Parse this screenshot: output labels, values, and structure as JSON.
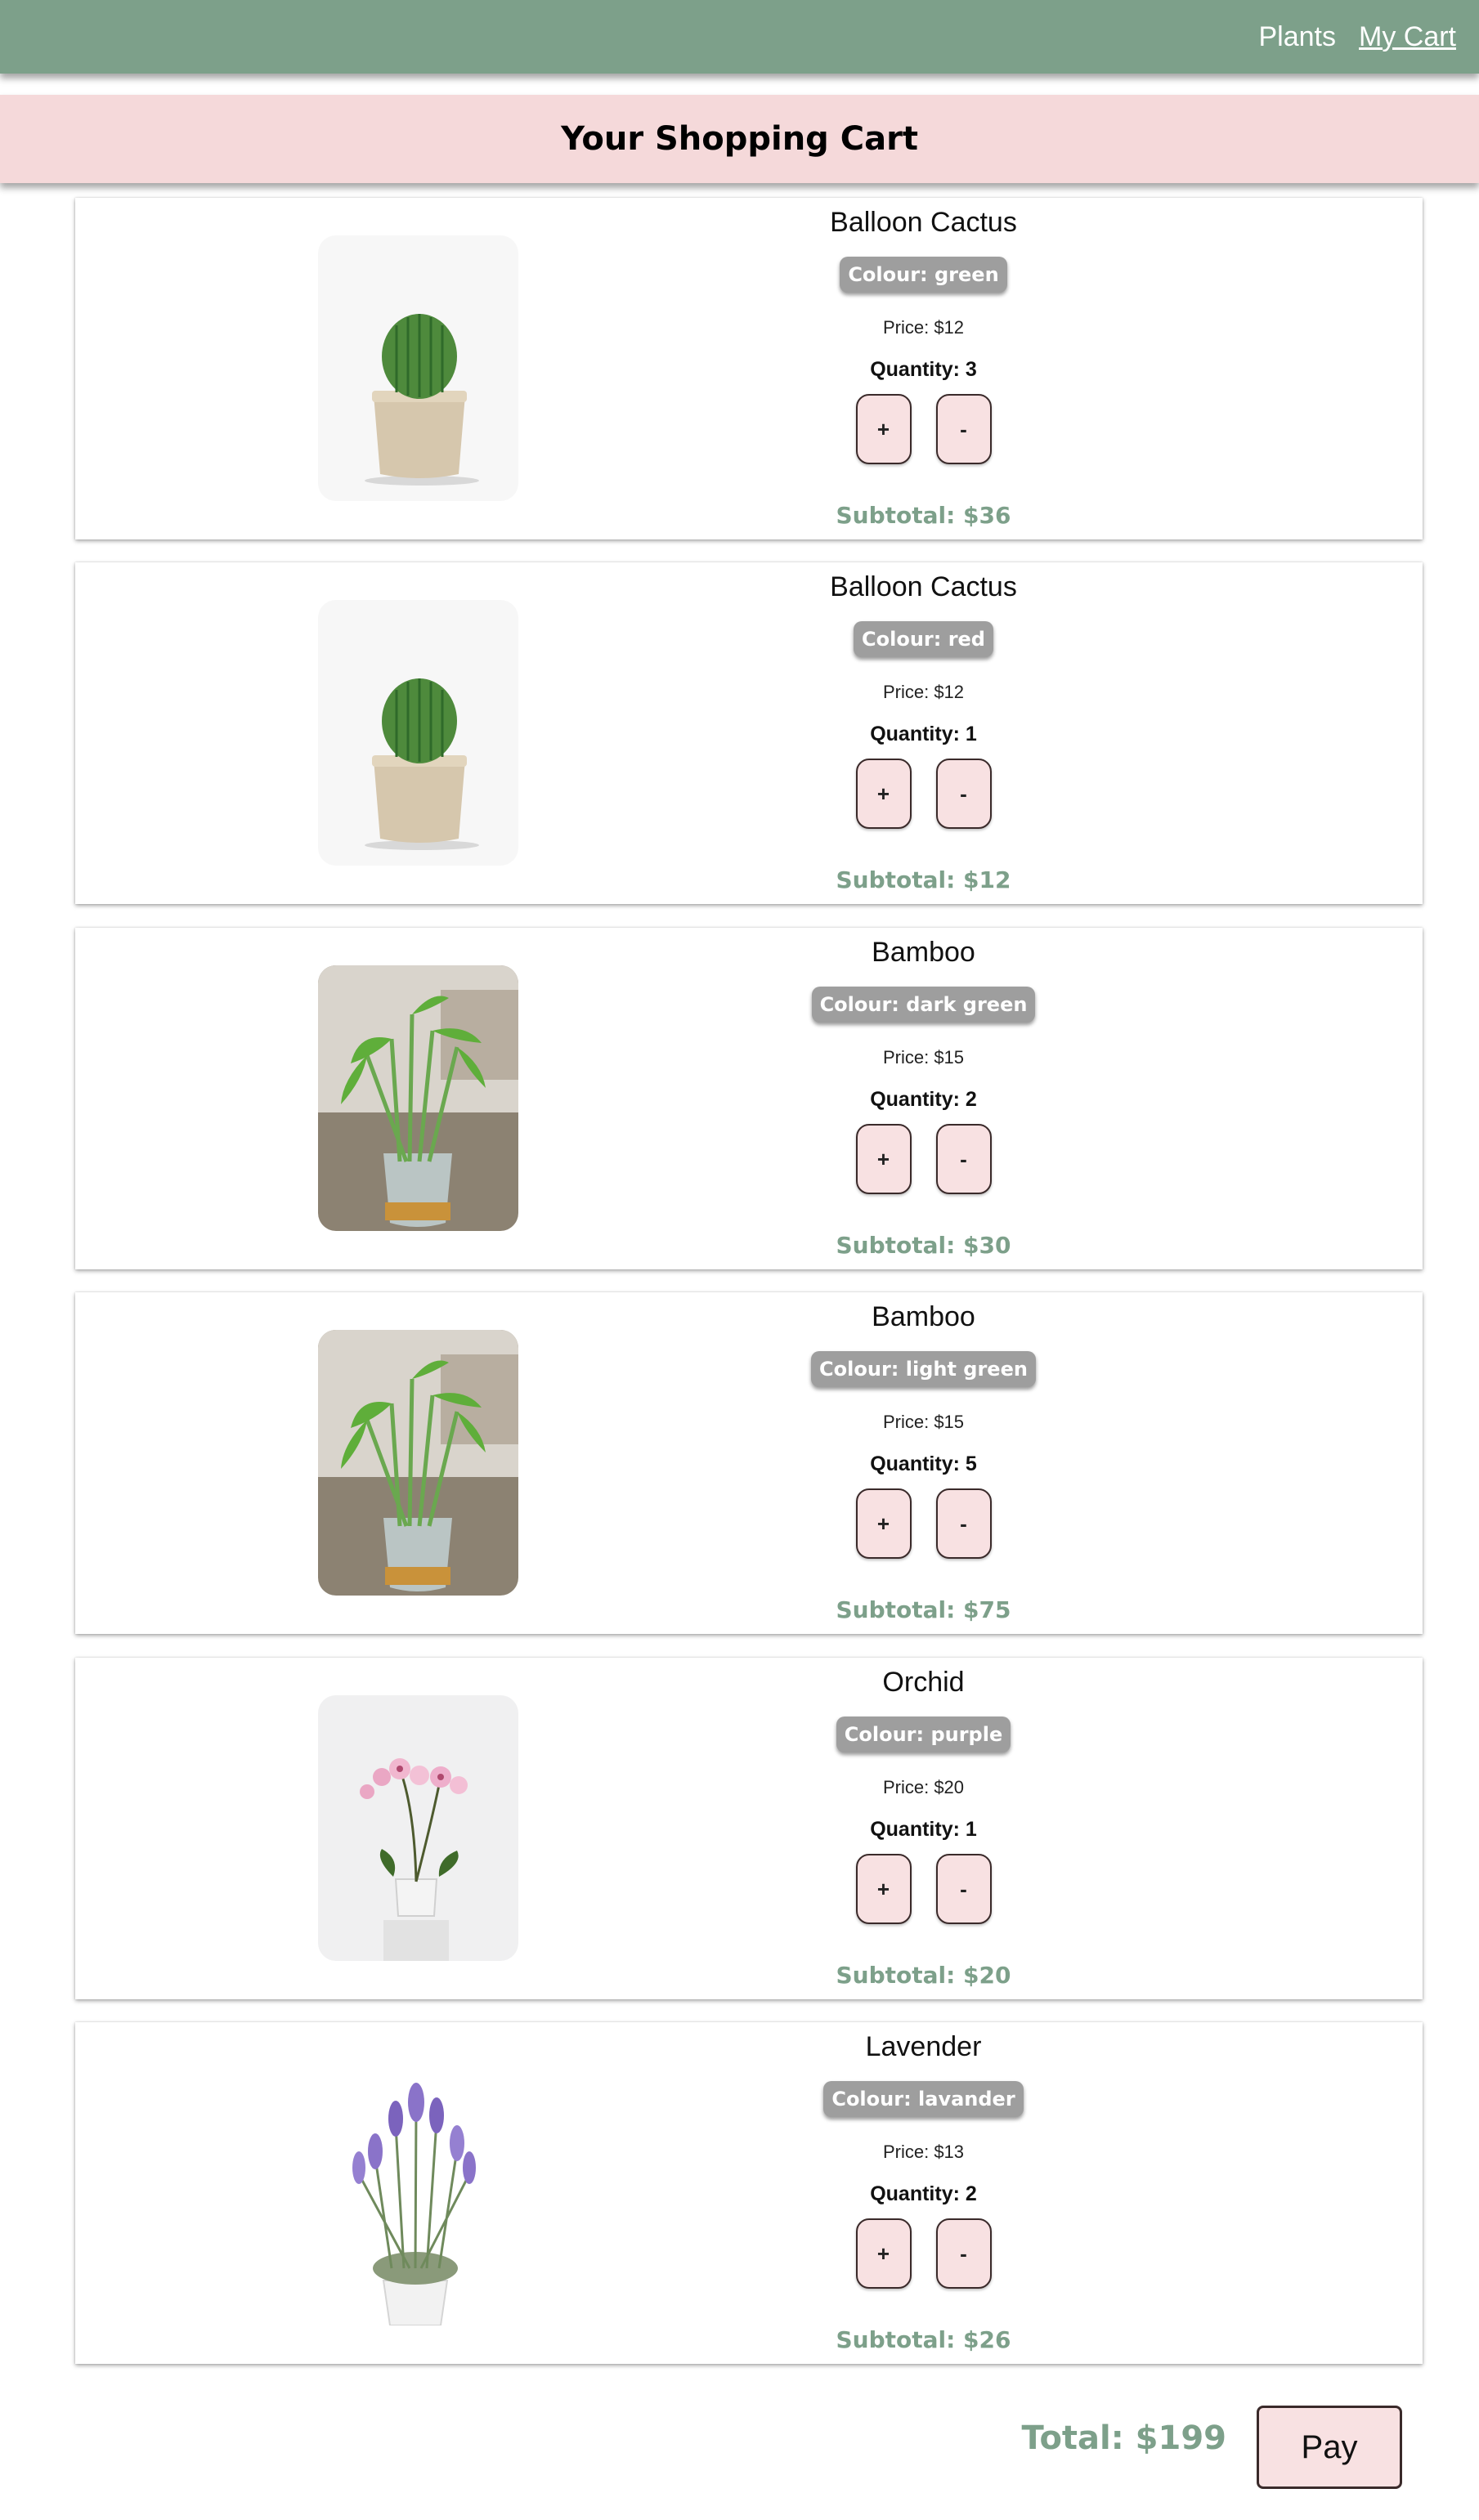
{
  "nav": {
    "plants_label": "Plants",
    "cart_label": "My Cart"
  },
  "header": {
    "title": "Your Shopping Cart"
  },
  "items": [
    {
      "name": "Balloon Cactus",
      "colour": "Colour: green",
      "price": "Price: $12",
      "quantity": "Quantity: 3",
      "plus": "+",
      "minus": "-",
      "subtotal": "Subtotal: $36",
      "image": "cactus"
    },
    {
      "name": "Balloon Cactus",
      "colour": "Colour: red",
      "price": "Price: $12",
      "quantity": "Quantity: 1",
      "plus": "+",
      "minus": "-",
      "subtotal": "Subtotal: $12",
      "image": "cactus"
    },
    {
      "name": "Bamboo",
      "colour": "Colour: dark green",
      "price": "Price: $15",
      "quantity": "Quantity: 2",
      "plus": "+",
      "minus": "-",
      "subtotal": "Subtotal: $30",
      "image": "bamboo"
    },
    {
      "name": "Bamboo",
      "colour": "Colour: light green",
      "price": "Price: $15",
      "quantity": "Quantity: 5",
      "plus": "+",
      "minus": "-",
      "subtotal": "Subtotal: $75",
      "image": "bamboo"
    },
    {
      "name": "Orchid",
      "colour": "Colour: purple",
      "price": "Price: $20",
      "quantity": "Quantity: 1",
      "plus": "+",
      "minus": "-",
      "subtotal": "Subtotal: $20",
      "image": "orchid"
    },
    {
      "name": "Lavender",
      "colour": "Colour: lavander",
      "price": "Price: $13",
      "quantity": "Quantity: 2",
      "plus": "+",
      "minus": "-",
      "subtotal": "Subtotal: $26",
      "image": "lavender"
    }
  ],
  "footer": {
    "total": "Total: $199",
    "pay_label": "Pay"
  },
  "colors": {
    "nav_green": "#7da08a",
    "header_pink": "#f5d9da",
    "button_pink": "#f8e1e2",
    "badge_gray": "#9e9e9e"
  }
}
